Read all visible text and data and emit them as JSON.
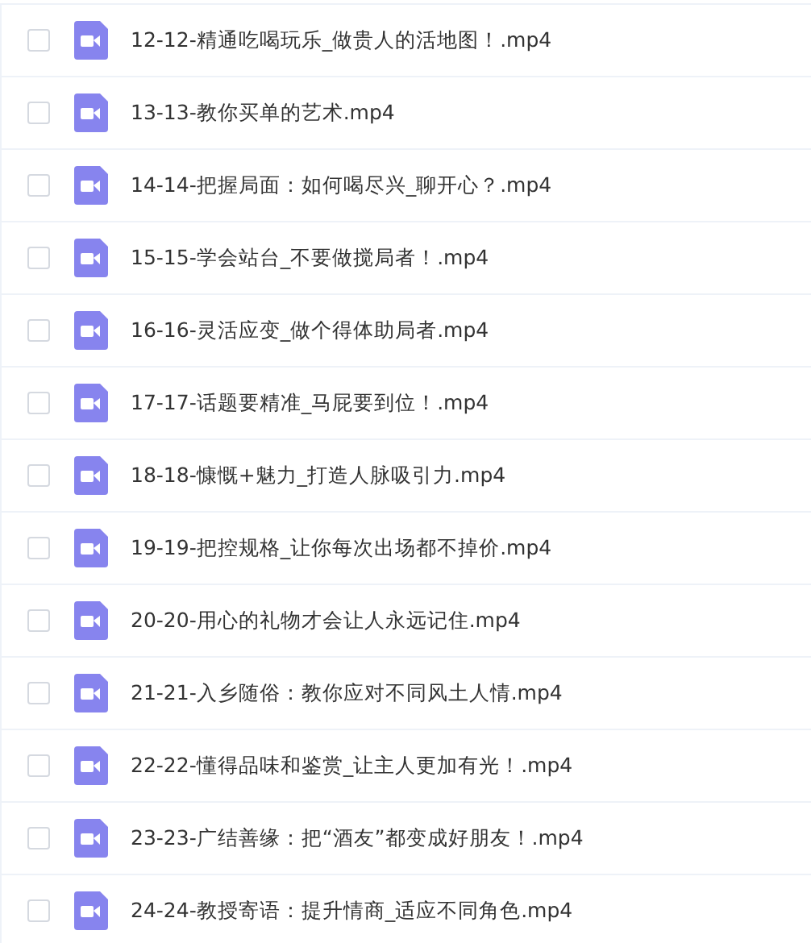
{
  "files": [
    {
      "name": "12-12-精通吃喝玩乐_做贵人的活地图！.mp4",
      "checked": false
    },
    {
      "name": "13-13-教你买单的艺术.mp4",
      "checked": false
    },
    {
      "name": "14-14-把握局面：如何喝尽兴_聊开心？.mp4",
      "checked": false
    },
    {
      "name": "15-15-学会站台_不要做搅局者！.mp4",
      "checked": false
    },
    {
      "name": "16-16-灵活应变_做个得体助局者.mp4",
      "checked": false
    },
    {
      "name": "17-17-话题要精准_马屁要到位！.mp4",
      "checked": false
    },
    {
      "name": "18-18-慷慨+魅力_打造人脉吸引力.mp4",
      "checked": false
    },
    {
      "name": "19-19-把控规格_让你每次出场都不掉价.mp4",
      "checked": false
    },
    {
      "name": "20-20-用心的礼物才会让人永远记住.mp4",
      "checked": false
    },
    {
      "name": "21-21-入乡随俗：教你应对不同风土人情.mp4",
      "checked": false
    },
    {
      "name": "22-22-懂得品味和鉴赏_让主人更加有光！.mp4",
      "checked": false
    },
    {
      "name": "23-23-广结善缘：把“酒友”都变成好朋友！.mp4",
      "checked": false
    },
    {
      "name": "24-24-教授寄语：提升情商_适应不同角色.mp4",
      "checked": false
    }
  ]
}
